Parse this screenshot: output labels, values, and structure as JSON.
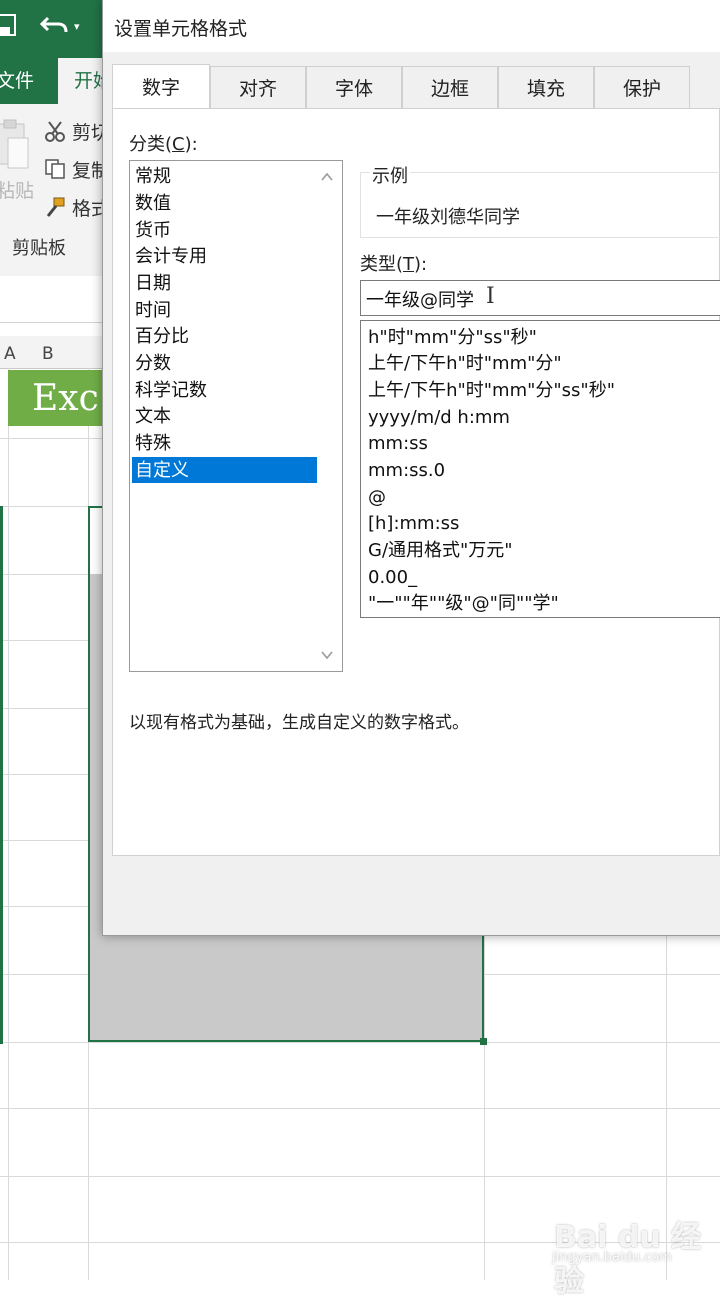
{
  "excel": {
    "tab_file": "文件",
    "tab_home": "开始",
    "ribbon": {
      "paste_label": "粘贴",
      "cut_label": "剪切",
      "copy_label": "复制",
      "format_painter_label": "格式",
      "group_label": "剪贴板"
    },
    "column_a": "A",
    "column_b": "B",
    "sheet_title_fragment": "Exc"
  },
  "dialog": {
    "title": "设置单元格格式",
    "tabs": [
      {
        "label": "数字",
        "active": true
      },
      {
        "label": "对齐",
        "active": false
      },
      {
        "label": "字体",
        "active": false
      },
      {
        "label": "边框",
        "active": false
      },
      {
        "label": "填充",
        "active": false
      },
      {
        "label": "保护",
        "active": false
      }
    ],
    "category_label": "分类(",
    "category_hotkey": "C",
    "category_label_end": "):",
    "categories": [
      "常规",
      "数值",
      "货币",
      "会计专用",
      "日期",
      "时间",
      "百分比",
      "分数",
      "科学记数",
      "文本",
      "特殊",
      "自定义"
    ],
    "selected_category": "自定义",
    "sample_label": "示例",
    "sample_value": "一年级刘德华同学",
    "type_label": "类型(",
    "type_hotkey": "T",
    "type_label_end": "):",
    "type_value": "一年级@同学",
    "format_list": [
      "h\"时\"mm\"分\"ss\"秒\"",
      "上午/下午h\"时\"mm\"分\"",
      "上午/下午h\"时\"mm\"分\"ss\"秒\"",
      "yyyy/m/d h:mm",
      "mm:ss",
      "mm:ss.0",
      "@",
      "[h]:mm:ss",
      "G/通用格式\"万元\"",
      "0.00_",
      "\"一\"\"年\"\"级\"@\"同\"\"学\""
    ],
    "description": "以现有格式为基础，生成自定义的数字格式。"
  },
  "watermark": {
    "logo": "Bai du 经验",
    "url": "jingyan.baidu.com"
  },
  "colors": {
    "excel_green": "#217346",
    "header_green": "#70ad47",
    "selection_blue": "#0078d7"
  }
}
